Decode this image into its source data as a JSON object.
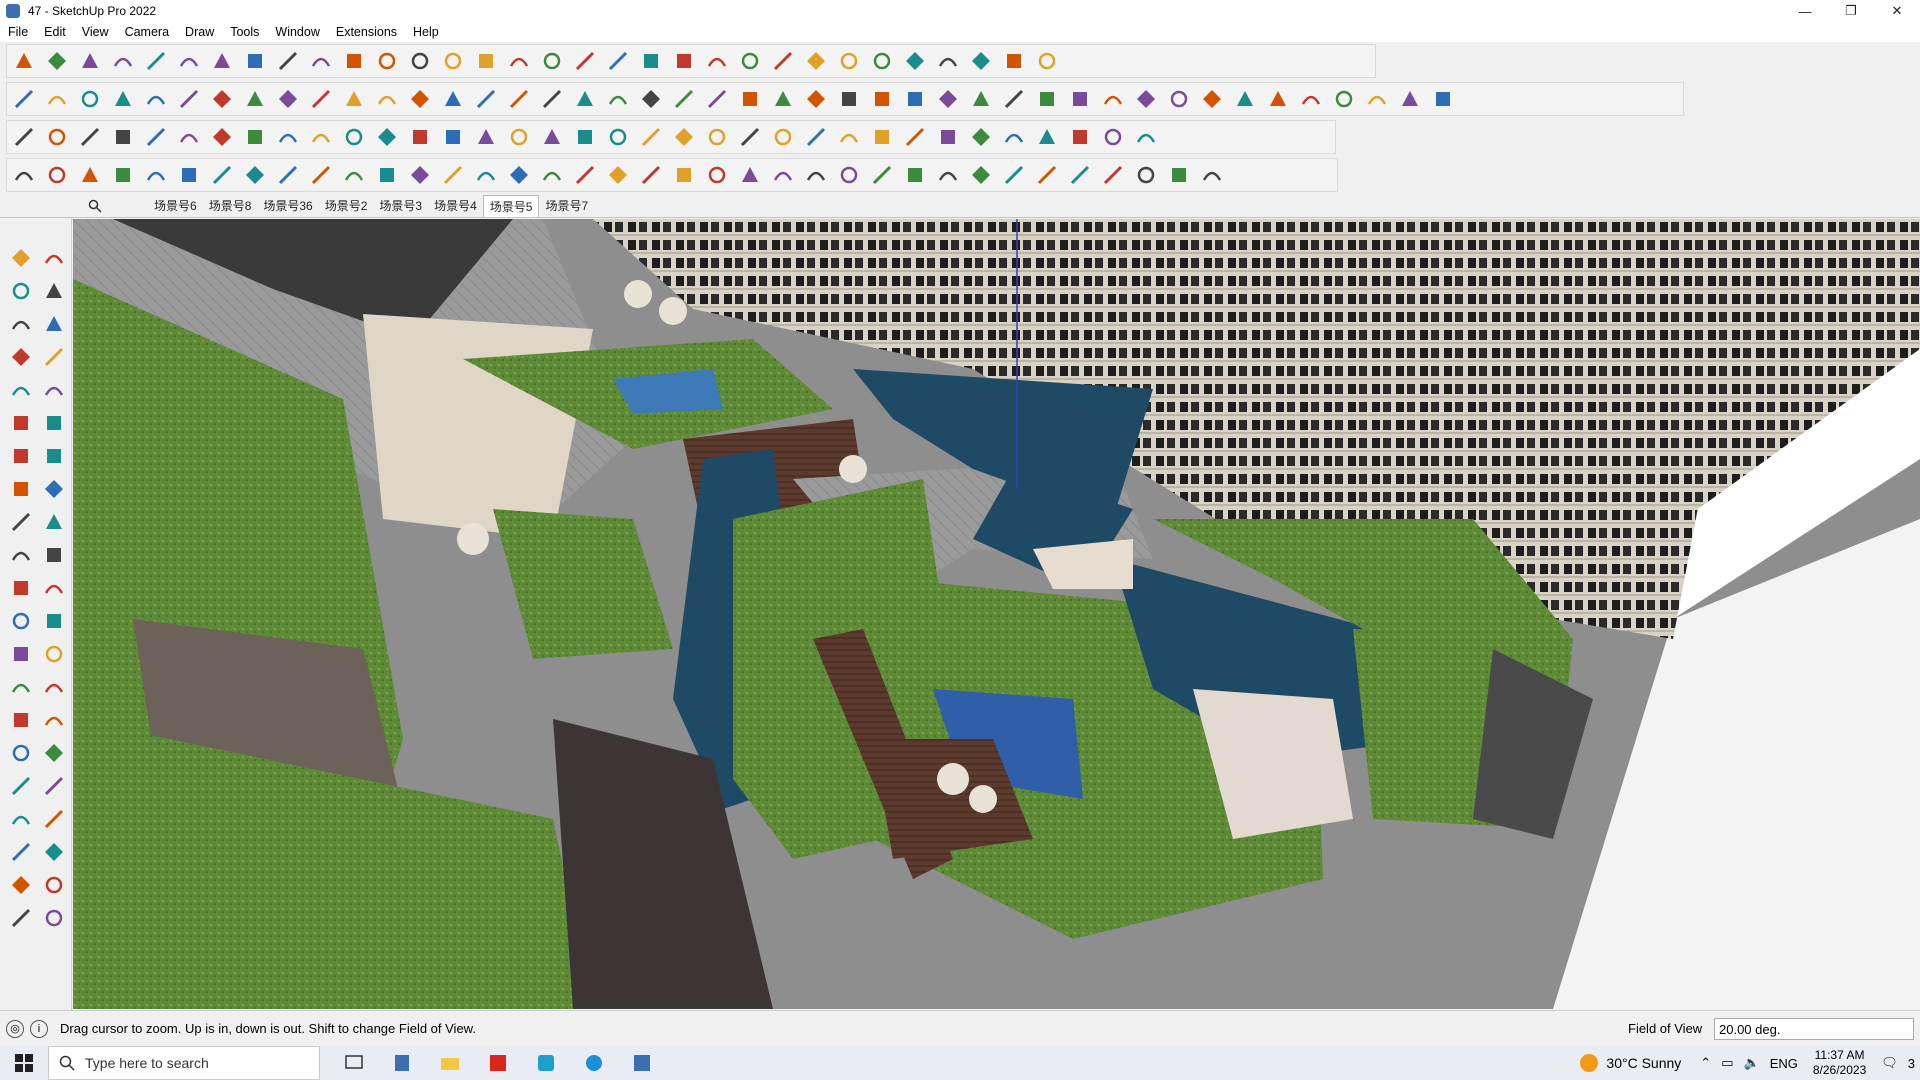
{
  "window": {
    "title": "47 - SketchUp Pro 2022",
    "minimize_glyph": "—",
    "maximize_glyph": "❐",
    "close_glyph": "✕"
  },
  "menu": [
    "File",
    "Edit",
    "View",
    "Camera",
    "Draw",
    "Tools",
    "Window",
    "Extensions",
    "Help"
  ],
  "scenes": {
    "tabs": [
      "场景号6",
      "场景号8",
      "场景号36",
      "场景号2",
      "场景号3",
      "场景号4",
      "场景号5",
      "场景号7"
    ],
    "active": "场景号5"
  },
  "toolbars": {
    "row1_icons": [
      "search-icon",
      "select-icon",
      "eraser-icon",
      "pencil-icon",
      "freehand-icon",
      "rectangle-icon",
      "push-pull-icon",
      "follow-me-icon",
      "move-icon",
      "rotate-icon",
      "scale-icon",
      "tape-measure-icon",
      "text-icon",
      "paint-bucket-icon",
      "orbit-icon",
      "pan-icon",
      "zoom-icon",
      "zoom-extents-icon",
      "sandbox-icon",
      "layers-icon",
      "styles-icon",
      "shadows-icon",
      "profile-icon",
      "import-icon",
      "export-icon",
      "section-icon",
      "flip-icon",
      "arrows-icon",
      "axes-icon",
      "undo-icon",
      "redo-icon",
      "warehouse-icon"
    ],
    "row2_icons": [
      "iso-view-icon",
      "top-view-icon",
      "front-view-icon",
      "push-icon",
      "solid-tools-icon",
      "union-icon",
      "subtract-icon",
      "trim-icon",
      "split-icon",
      "intersect-icon",
      "outer-shell-icon",
      "curve-icon",
      "section-plane-icon",
      "section-cut-icon",
      "section-fill-icon",
      "sandbox-icon",
      "smoove-icon",
      "house-icon",
      "house-outline-icon",
      "shed-icon",
      "home-icon",
      "garage-icon",
      "dimension-icon",
      "tag-icon",
      "eraser-red-icon",
      "polygon-icon",
      "polygon-icon",
      "circle-icon",
      "ellipse-icon",
      "hexagon-icon",
      "parallelogram-icon",
      "arc-icon",
      "lasso-icon",
      "spline-icon",
      "loop-icon",
      "red-arrow-icon",
      "pink-cube-icon",
      "plane-icon",
      "grid-icon",
      "move-3d-icon",
      "stamp-icon",
      "camera-icon",
      "panel-icon",
      "stack-icon"
    ],
    "row3_icons": [
      "blue-plane-icon",
      "blue-diamond-icon",
      "yellow-plane-icon",
      "label-icon",
      "layer-icon",
      "curve-icon",
      "flag-icon",
      "wall-icon",
      "frame-icon",
      "wood-icon",
      "chain-icon",
      "link-icon",
      "node-icon",
      "plus-icon",
      "x-icon",
      "cone-icon",
      "volcano-icon",
      "triangle-icon",
      "spiral-icon",
      "twist-icon",
      "knot-icon",
      "nodes-icon",
      "rotate-cube-icon",
      "hook-icon",
      "block-icon",
      "connector-icon",
      "cubes-icon",
      "lock-icon",
      "tile-icon",
      "window-icon",
      "texture-icon",
      "grid-icon",
      "scatter-icon",
      "dotted-circle-icon",
      "array-icon"
    ],
    "row4_icons": [
      "line-tool-icon",
      "bezier-icon",
      "bucket-icon",
      "tile-icon",
      "stair-icon",
      "arc-icon",
      "sphere-icon",
      "leaf-icon",
      "spring-icon",
      "fold-icon",
      "frame-icon",
      "ray-icon",
      "pipe-icon",
      "bend-icon",
      "path-icon",
      "sweep-icon",
      "fan-icon",
      "hand-icon",
      "leaf-icon",
      "fold-icon",
      "stack-icon",
      "diag-icon",
      "cross-icon",
      "arrow-icon",
      "arrow-icon",
      "box-icon",
      "stripe-icon",
      "column-icon",
      "frame-icon",
      "pattern-icon",
      "stripe-icon",
      "grille-icon",
      "gear-icon",
      "gear-icon",
      "fin-icon",
      "lattice-icon",
      "mesh-icon"
    ]
  },
  "left_tools": [
    "select-icon",
    "orbit-lasso-icon",
    "paint-bucket-icon",
    "eraser-icon",
    "component-icon",
    "tag-icon",
    "line-icon",
    "freehand-icon",
    "rectangle-icon",
    "rotated-rectangle-icon",
    "circle-icon",
    "polygon-icon",
    "arc-icon",
    "two-point-arc-icon",
    "three-point-arc-icon",
    "pie-icon",
    "move-icon",
    "push-pull-icon",
    "rotate-icon",
    "follow-me-icon",
    "scale-icon",
    "offset-icon",
    "tape-measure-icon",
    "dimension-icon",
    "protractor-icon",
    "text-icon",
    "axes-icon",
    "3d-text-icon",
    "orbit-icon",
    "pan-icon",
    "zoom-icon",
    "zoom-window-icon",
    "zoom-extents-icon",
    "previous-view-icon",
    "position-camera-icon",
    "look-around-icon",
    "walk-icon",
    "section-plane-icon",
    "sandbox-from-contours-icon",
    "sandbox-from-scratch-icon",
    "smoove-icon",
    "stamp-icon"
  ],
  "status": {
    "hint": "Drag cursor to zoom.  Up is in, down is out. Shift to change Field of View.",
    "fov_label": "Field of View",
    "fov_value": "20.00 deg."
  },
  "taskbar": {
    "search_placeholder": "Type here to search",
    "weather": "30°C  Sunny",
    "language": "ENG",
    "time": "11:37 AM",
    "date": "8/26/2023",
    "notification_count": "3"
  },
  "colors": {
    "accent": "#3a6fb0",
    "grass": "#5f8a37",
    "water": "#1f4a66",
    "deck": "#5c3a2e",
    "paving": "#9a9a9a",
    "building": "#d8d2c4"
  }
}
